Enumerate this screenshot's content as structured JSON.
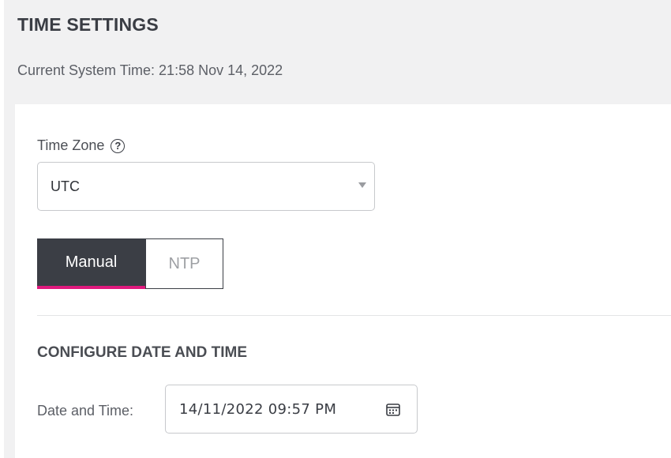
{
  "header": {
    "title": "TIME SETTINGS",
    "current_time": "Current System Time: 21:58 Nov 14, 2022"
  },
  "time_zone": {
    "label": "Time Zone",
    "help_icon": "question-circle-icon",
    "selected": "UTC"
  },
  "mode_toggle": {
    "options": [
      "Manual",
      "NTP"
    ],
    "active": "Manual"
  },
  "configure": {
    "title": "CONFIGURE DATE AND TIME",
    "datetime_label": "Date and Time:",
    "datetime_value": "14/11/2022 09:57 PM",
    "calendar_icon": "calendar-icon"
  },
  "colors": {
    "active_tab_bg": "#3b3e45",
    "active_tab_underline": "#e0197d",
    "page_bg": "#f1f1f2"
  }
}
